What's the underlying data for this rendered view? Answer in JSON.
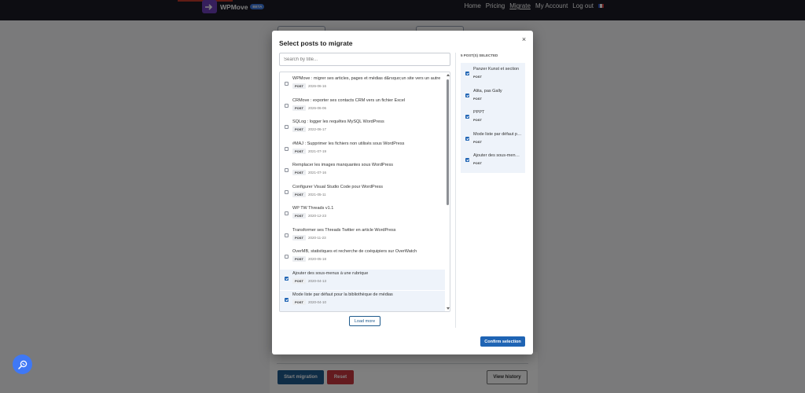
{
  "nav": {
    "brand": "WPMove",
    "badge": "BETA",
    "links": [
      "Home",
      "Pricing",
      "Migrate",
      "My Account",
      "Log out"
    ],
    "active": "Migrate"
  },
  "background": {
    "start_label": "Start migration",
    "reset_label": "Reset",
    "history_label": "View history"
  },
  "modal": {
    "title": "Select posts to migrate",
    "search_placeholder": "Search by title...",
    "posts": [
      {
        "title": "WPMove : migrer ses articles, pages et médias d&rsquo;un site vers un autre",
        "type": "POST",
        "date": "2026-06-16",
        "checked": false
      },
      {
        "title": "CRMove : exporter ses contacts CRM vers un fichier Excel",
        "type": "POST",
        "date": "2026-06-06",
        "checked": false
      },
      {
        "title": "SQLog : logger les requêtes MySQL WordPress",
        "type": "POST",
        "date": "2022-06-17",
        "checked": false
      },
      {
        "title": "#MAJ : Supprimer les fichiers non utilisés sous WordPress",
        "type": "POST",
        "date": "2021-07-19",
        "checked": false
      },
      {
        "title": "Remplacer les images manquantes sous WordPress",
        "type": "POST",
        "date": "2021-07-16",
        "checked": false
      },
      {
        "title": "Configurer Visual Studio Code pour WordPress",
        "type": "POST",
        "date": "2021-05-11",
        "checked": false
      },
      {
        "title": "WP TW Threads v1.1",
        "type": "POST",
        "date": "2020-12-23",
        "checked": false
      },
      {
        "title": "Transformer ses Threads Twitter en article WordPress",
        "type": "POST",
        "date": "2020-11-23",
        "checked": false
      },
      {
        "title": "OverMB, statistiques et recherche de coéquipiers sur OverWatch",
        "type": "POST",
        "date": "2020-05-18",
        "checked": false
      },
      {
        "title": "Ajouter des sous-menus à une rubrique",
        "type": "POST",
        "date": "2020-04-13",
        "checked": true
      },
      {
        "title": "Mode liste par défaut pour la bibliothèque de médias",
        "type": "POST",
        "date": "2020-04-10",
        "checked": true
      }
    ],
    "load_more_label": "Load more",
    "selected_heading": "5 POST(S) SELECTED",
    "selected": [
      {
        "title": "Panzer Kunst et section",
        "type": "POST"
      },
      {
        "title": "Alita, pas Gally",
        "type": "POST"
      },
      {
        "title": "PPPT",
        "type": "POST"
      },
      {
        "title": "Mode liste par défaut pour la bibliothèque de médias",
        "type": "POST"
      },
      {
        "title": "Ajouter des sous-menus à une rubrique",
        "type": "POST"
      }
    ],
    "close_symbol": "×",
    "confirm_label": "Confirm selection"
  },
  "colors": {
    "primary": "#1f64b4",
    "danger": "#c9363e",
    "nav_bg": "#1b1b25",
    "brand": "#6d3fb8",
    "fab": "#3f78f5"
  },
  "icons": {
    "fab": "magnifier-icon",
    "close": "close-icon",
    "logo": "arrow-right-icon"
  }
}
